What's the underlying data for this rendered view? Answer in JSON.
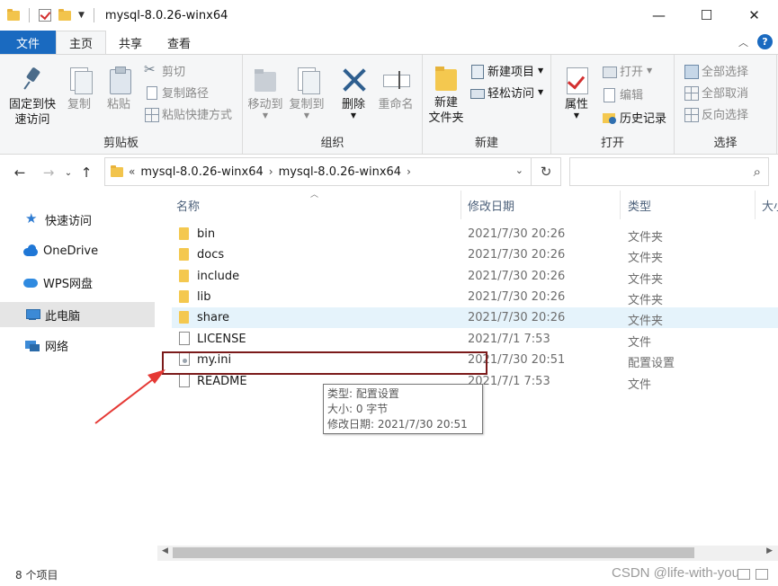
{
  "window": {
    "title": "mysql-8.0.26-winx64",
    "controls": {
      "minimize": "—",
      "maximize": "☐",
      "close": "✕"
    }
  },
  "ribbon_tabs": {
    "file": "文件",
    "home": "主页",
    "share": "共享",
    "view": "查看"
  },
  "ribbon": {
    "clipboard": {
      "label": "剪贴板",
      "pin": "固定到快\n速访问",
      "pin_l1": "固定到快",
      "pin_l2": "速访问",
      "copy": "复制",
      "paste": "粘贴",
      "cut": "剪切",
      "copy_path": "复制路径",
      "paste_shortcut": "粘贴快捷方式"
    },
    "organize": {
      "label": "组织",
      "move_to": "移动到",
      "copy_to": "复制到",
      "delete": "删除",
      "rename": "重命名"
    },
    "new": {
      "label": "新建",
      "new_folder_l1": "新建",
      "new_folder_l2": "文件夹",
      "new_item": "新建项目",
      "easy_access": "轻松访问"
    },
    "open": {
      "label": "打开",
      "properties": "属性",
      "open": "打开",
      "edit": "编辑",
      "history": "历史记录"
    },
    "select": {
      "label": "选择",
      "select_all": "全部选择",
      "select_none": "全部取消",
      "invert": "反向选择"
    }
  },
  "address": {
    "overflow": "«",
    "crumbs": [
      "mysql-8.0.26-winx64",
      "mysql-8.0.26-winx64"
    ]
  },
  "search": {
    "placeholder": ""
  },
  "nav_pane": {
    "items": [
      {
        "label": "快速访问",
        "icon": "star-icon"
      },
      {
        "label": "OneDrive",
        "icon": "onedrive-icon"
      },
      {
        "label": "WPS网盘",
        "icon": "wps-cloud-icon"
      },
      {
        "label": "此电脑",
        "icon": "computer-icon"
      },
      {
        "label": "网络",
        "icon": "network-icon"
      }
    ]
  },
  "columns": {
    "name": "名称",
    "date": "修改日期",
    "type": "类型",
    "size": "大小"
  },
  "files": [
    {
      "name": "bin",
      "date": "2021/7/30 20:26",
      "type": "文件夹",
      "kind": "folder"
    },
    {
      "name": "docs",
      "date": "2021/7/30 20:26",
      "type": "文件夹",
      "kind": "folder"
    },
    {
      "name": "include",
      "date": "2021/7/30 20:26",
      "type": "文件夹",
      "kind": "folder"
    },
    {
      "name": "lib",
      "date": "2021/7/30 20:26",
      "type": "文件夹",
      "kind": "folder"
    },
    {
      "name": "share",
      "date": "2021/7/30 20:26",
      "type": "文件夹",
      "kind": "folder"
    },
    {
      "name": "LICENSE",
      "date": "2021/7/1 7:53",
      "type": "文件",
      "kind": "file"
    },
    {
      "name": "my.ini",
      "date": "2021/7/30 20:51",
      "type": "配置设置",
      "kind": "ini"
    },
    {
      "name": "README",
      "date": "2021/7/1 7:53",
      "type": "文件",
      "kind": "file"
    }
  ],
  "tooltip": {
    "type_line": "类型: 配置设置",
    "size_line": "大小: 0 字节",
    "date_line": "修改日期: 2021/7/30 20:51"
  },
  "status": {
    "count": "8 个项目"
  },
  "watermark": "CSDN @life-with-you",
  "colors": {
    "accent": "#1a6ac0",
    "highlight_row": "#e5f3fb",
    "annotation": "#7b1a1a",
    "arrow": "#e53935"
  }
}
